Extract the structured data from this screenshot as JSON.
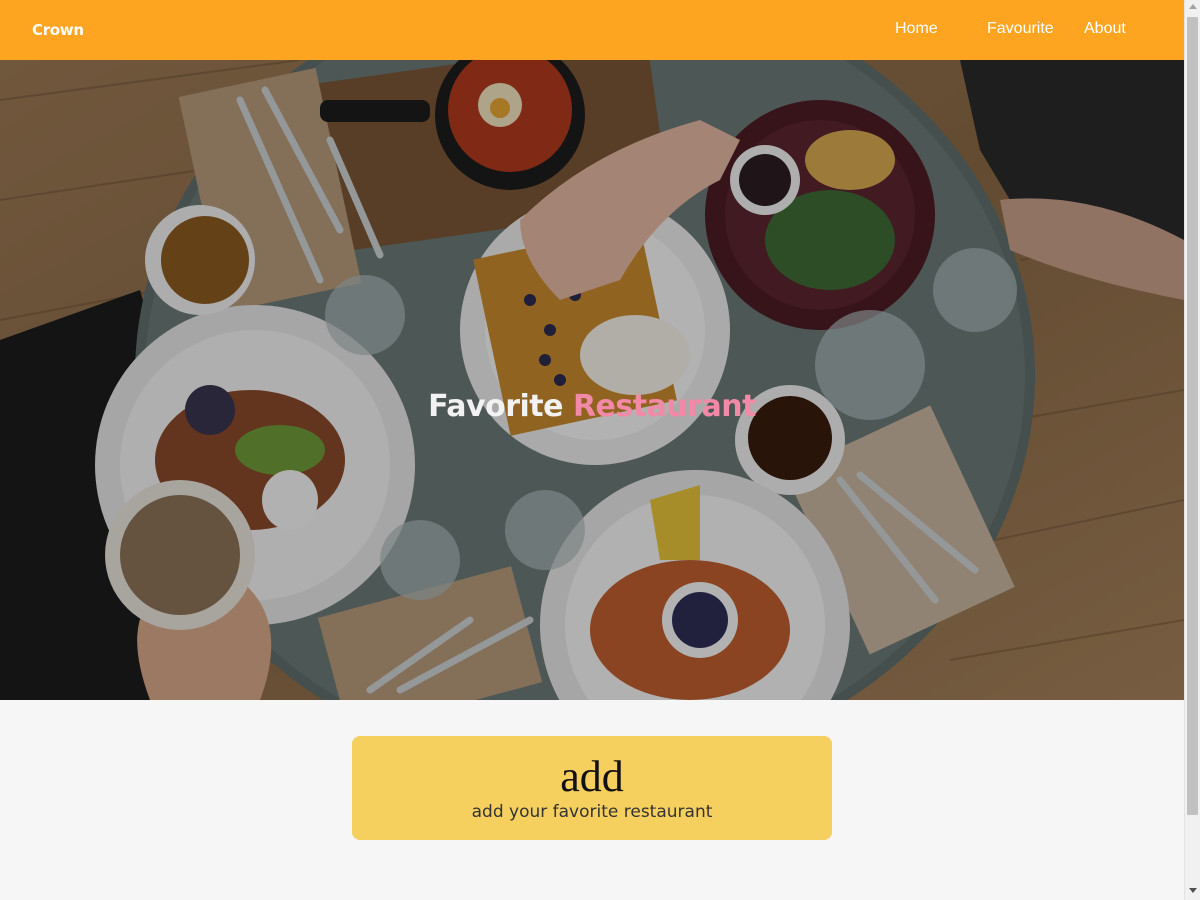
{
  "header": {
    "brand": "Crown",
    "nav": {
      "home": "Home",
      "favourite": "Favourite",
      "about": "About"
    },
    "background": "#fda521"
  },
  "hero": {
    "title_part1": "Favorite",
    "title_part2": "Restaurant",
    "accent_color": "#f28aa7",
    "image_description_icon": "breakfast-table-photo"
  },
  "card": {
    "title": "add",
    "subtitle": "add your favorite restaurant",
    "background": "#f5d05e"
  }
}
